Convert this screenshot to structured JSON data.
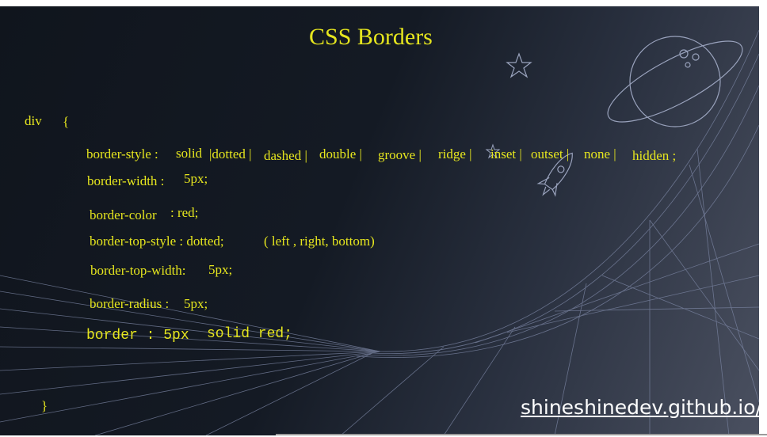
{
  "title": "CSS Borders",
  "selector": "div",
  "open_brace": "{",
  "close_brace": "}",
  "lines": {
    "style_label": "border-style :",
    "style_values": [
      "solid",
      "|dotted |",
      "dashed |",
      "double |",
      "groove |",
      "ridge |",
      "inset |",
      "outset |",
      "none |",
      "hidden ;"
    ],
    "width_label": "border-width :",
    "width_value": "5px;",
    "color_label": "border-color",
    "color_value": ": red;",
    "top_style_label": "border-top-style : dotted;",
    "top_style_note": "( left , right, bottom)",
    "top_width_label": "border-top-width:",
    "top_width_value": "5px;",
    "radius_label": "border-radius :",
    "radius_value": "5px;",
    "shorthand_a": "border : 5px",
    "shorthand_b": "solid red;"
  },
  "watermark": "shineshinedev.github.io/me",
  "colors": {
    "text": "#e6e61e",
    "background": "#131922",
    "art": "#8a93b0"
  }
}
